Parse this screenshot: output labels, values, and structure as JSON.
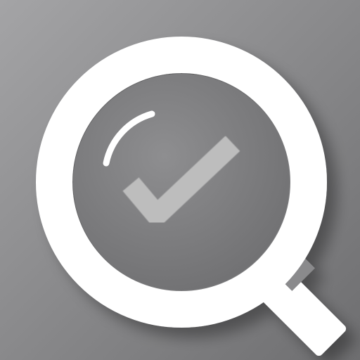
{
  "app_icon": {
    "name": "magnifier-check-icon",
    "colors": {
      "background_light": "#a4a4a6",
      "background_dark": "#6e6e70",
      "lens_fill": "#7d7d7f",
      "ring": "#ffffff",
      "handle": "#ffffff",
      "handle_joint": "#8a8a8c",
      "checkmark": "#bdbdbd",
      "highlight": "#ffffff"
    }
  }
}
